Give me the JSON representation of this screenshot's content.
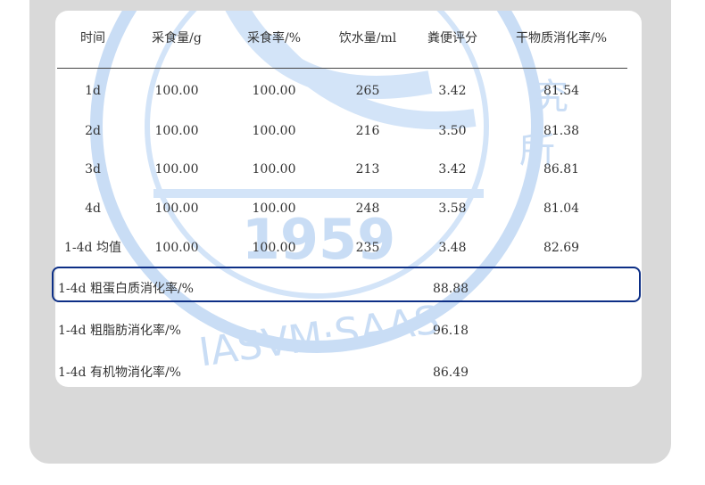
{
  "colors": {
    "panel": "#d9d9d9",
    "card": "#ffffff",
    "text": "#333333",
    "highlight_border": "#0d2f86",
    "watermark": "#c9ddf5"
  },
  "table": {
    "headers": [
      "时间",
      "采食量/g",
      "采食率/%",
      "饮水量/ml",
      "粪便评分",
      "干物质消化率/%"
    ],
    "rows": [
      [
        "1d",
        "100.00",
        "100.00",
        "265",
        "3.42",
        "81.54"
      ],
      [
        "2d",
        "100.00",
        "100.00",
        "216",
        "3.50",
        "81.38"
      ],
      [
        "3d",
        "100.00",
        "100.00",
        "213",
        "3.42",
        "86.81"
      ],
      [
        "4d",
        "100.00",
        "100.00",
        "248",
        "3.58",
        "81.04"
      ],
      [
        "1-4d 均值",
        "100.00",
        "100.00",
        "235",
        "3.48",
        "82.69"
      ]
    ],
    "digestibility": [
      {
        "label": "1-4d 粗蛋白质消化率/%",
        "value": "88.88"
      },
      {
        "label": "1-4d 粗脂肪消化率/%",
        "value": "96.18"
      },
      {
        "label": "1-4d 有机物消化率/%",
        "value": "86.49"
      }
    ]
  },
  "watermark": {
    "year": "1959",
    "ring_text": "IASVM·SAAS",
    "glyph_1": "究",
    "glyph_2": "所"
  }
}
